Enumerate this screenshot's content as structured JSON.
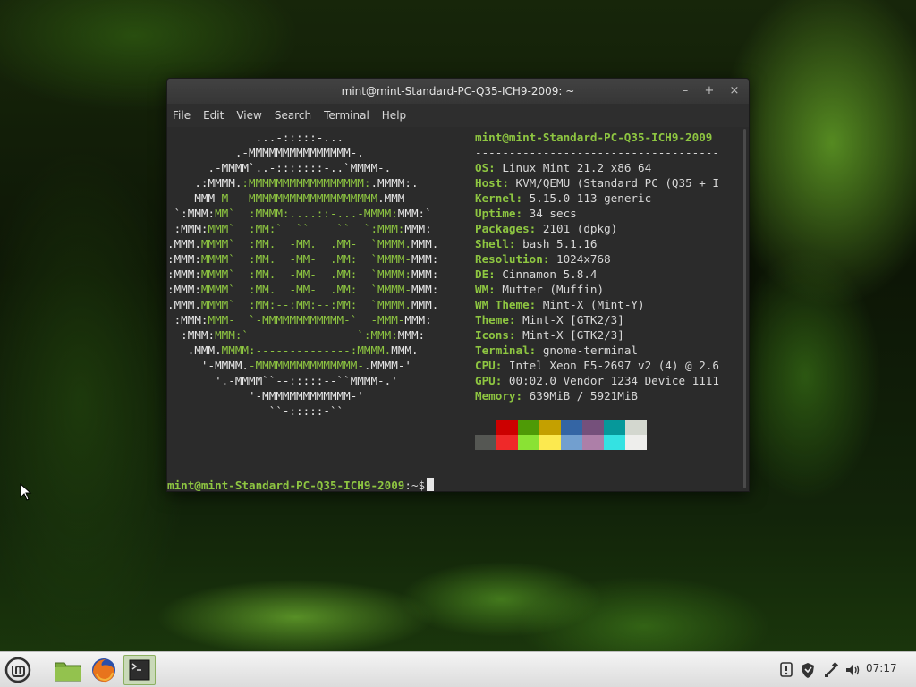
{
  "window": {
    "title": "mint@mint-Standard-PC-Q35-ICH9-2009: ~",
    "controls": {
      "minimize": "–",
      "maximize": "+",
      "close": "×"
    }
  },
  "menubar": {
    "items": [
      "File",
      "Edit",
      "View",
      "Search",
      "Terminal",
      "Help"
    ]
  },
  "neofetch": {
    "user_host": "mint@mint-Standard-PC-Q35-ICH9-2009",
    "separator": "------------------------------------",
    "fields": [
      {
        "key": "OS",
        "value": "Linux Mint 21.2 x86_64"
      },
      {
        "key": "Host",
        "value": "KVM/QEMU (Standard PC (Q35 + I"
      },
      {
        "key": "Kernel",
        "value": "5.15.0-113-generic"
      },
      {
        "key": "Uptime",
        "value": "34 secs"
      },
      {
        "key": "Packages",
        "value": "2101 (dpkg)"
      },
      {
        "key": "Shell",
        "value": "bash 5.1.16"
      },
      {
        "key": "Resolution",
        "value": "1024x768"
      },
      {
        "key": "DE",
        "value": "Cinnamon 5.8.4"
      },
      {
        "key": "WM",
        "value": "Mutter (Muffin)"
      },
      {
        "key": "WM Theme",
        "value": "Mint-X (Mint-Y)"
      },
      {
        "key": "Theme",
        "value": "Mint-X [GTK2/3]"
      },
      {
        "key": "Icons",
        "value": "Mint-X [GTK2/3]"
      },
      {
        "key": "Terminal",
        "value": "gnome-terminal"
      },
      {
        "key": "CPU",
        "value": "Intel Xeon E5-2697 v2 (4) @ 2.6"
      },
      {
        "key": "GPU",
        "value": "00:02.0 Vendor 1234 Device 1111"
      },
      {
        "key": "Memory",
        "value": "639MiB / 5921MiB"
      }
    ],
    "palette_top": [
      "#2b2b2b",
      "#cc0000",
      "#4e9a06",
      "#c4a000",
      "#3465a4",
      "#75507b",
      "#06989a",
      "#d3d7cf"
    ],
    "palette_bottom": [
      "#555753",
      "#ef2929",
      "#8ae234",
      "#fce94f",
      "#729fcf",
      "#ad7fa8",
      "#34e2e2",
      "#eeeeec"
    ]
  },
  "prompt": {
    "user": "mint@mint-Standard-PC-Q35-ICH9-2009",
    "dir": ":~$"
  },
  "panel": {
    "clock": "07:17"
  }
}
